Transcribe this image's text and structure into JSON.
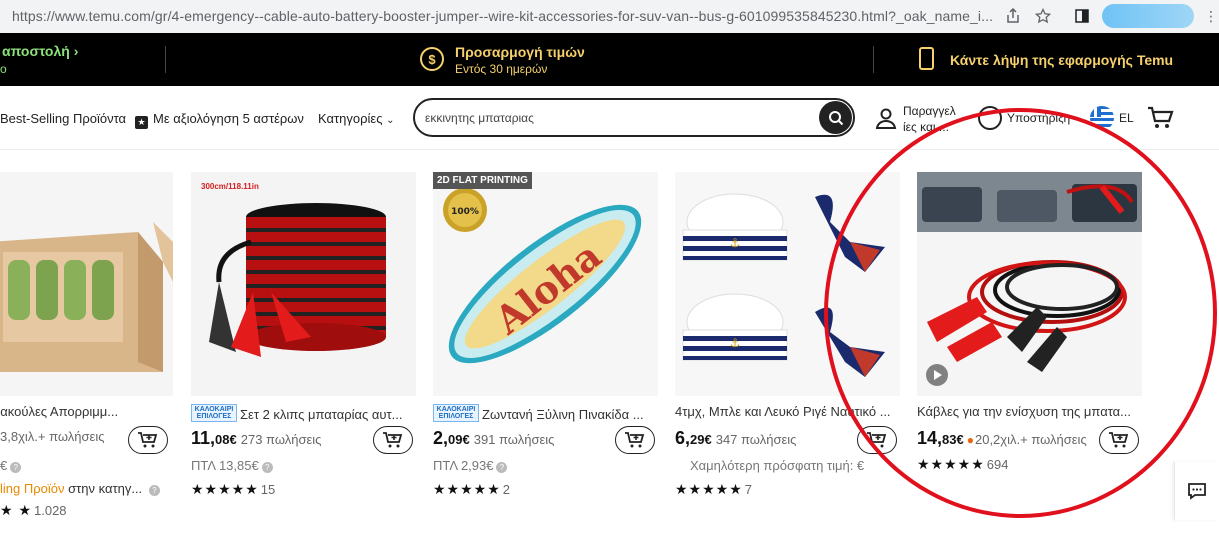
{
  "browser": {
    "url": "https://www.temu.com/gr/4-emergency--cable-auto-battery-booster-jumper--wire-kit-accessories-for-suv-van--bus-g-601099535845230.html?_oak_name_i..."
  },
  "promo": {
    "left_line1": "αποστολή",
    "left_line2": "ο",
    "middle_title": "Προσαρμογή τιμών",
    "middle_sub": "Εντός 30 ημερών",
    "middle_icon_symbol": "$",
    "right_text": "Κάντε λήψη της εφαρμογής Temu"
  },
  "nav": {
    "best_selling": "Best-Selling Προϊόντα",
    "five_star": "Με αξιολόγηση 5 αστέρων",
    "categories": "Κατηγορίες",
    "search_value": "εκκινητης μπαταριας",
    "orders_line1": "Παραγγελ",
    "orders_line2": "ίες και ...",
    "support": "Υποστήριξη",
    "language": "EL"
  },
  "products": [
    {
      "title": "βροχες Σακούλες Απορριμμ...",
      "price_int": "",
      "price_dec": "",
      "sold": "3,8χιλ.+ πωλήσεις",
      "sub": "€",
      "sub_highlight": "ling Προϊόν",
      "sub_rest": "στην κατηγ...",
      "stars": "★ ★",
      "rating_count": "1.028",
      "badge": "",
      "img_label": ""
    },
    {
      "title": "Σετ 2 κλιπς μπαταρίας αυτ...",
      "price_int": "11,",
      "price_dec": "08€",
      "sold": "273 πωλήσεις",
      "sub": "ΠΤΛ 13,85€",
      "stars": "★★★★★",
      "rating_count": "15",
      "badge": "ΚΑΛΟΚΑΙΡΙ ΕΠΙΛΟΓΕΣ",
      "img_label": "300cm/118.11in"
    },
    {
      "title": "Ζωντανή Ξύλινη Πινακίδα ...",
      "price_int": "2,",
      "price_dec": "09€",
      "sold": "391 πωλήσεις",
      "sub": "ΠΤΛ 2,93€",
      "stars": "★★★★★",
      "rating_count": "2",
      "badge": "ΚΑΛΟΚΑΙΡΙ ΕΠΙΛΟΓΕΣ",
      "img_label": "2D FLAT PRINTING",
      "img_text": "Aloha",
      "img_seal": "100%"
    },
    {
      "title": "4τμχ, Μπλε και Λευκό Ριγέ Ναυτικό ...",
      "price_int": "6,",
      "price_dec": "29€",
      "sold": "347 πωλήσεις",
      "sub": "Χαμηλότερη πρόσφατη τιμή: €",
      "stars": "★★★★★",
      "rating_count": "7",
      "badge": ""
    },
    {
      "title": "Κάβλες για την ενίσχυση της μπατα...",
      "price_int": "14,",
      "price_dec": "83€",
      "sold": "20,2χιλ.+ πωλήσεις",
      "sub": "",
      "stars": "★★★★★",
      "rating_count": "694",
      "badge": ""
    }
  ],
  "colors": {
    "promo_green": "#8ce27a",
    "promo_yellow": "#f5d16b",
    "annotation_red": "#e0101d",
    "sub_orange": "#e88a00"
  }
}
